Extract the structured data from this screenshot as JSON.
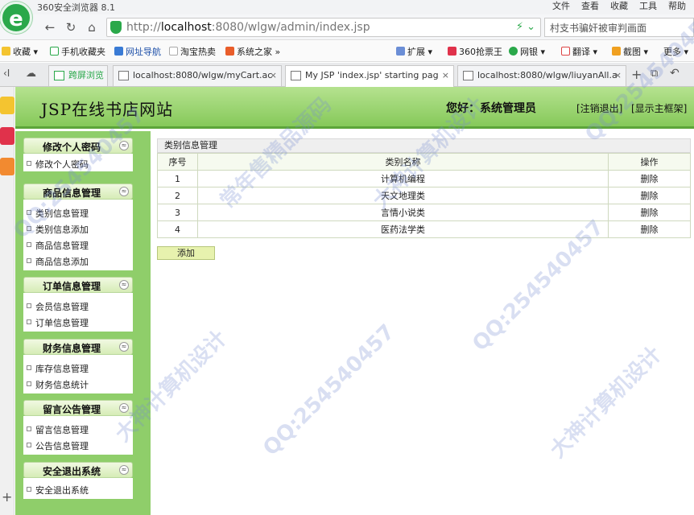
{
  "browser": {
    "title": "360安全浏览器 8.1",
    "logo_glyph": "e",
    "menu": [
      "文件",
      "查看",
      "收藏",
      "工具",
      "帮助"
    ],
    "address_prefix": "http://",
    "address_host": "localhost",
    "address_rest": ":8080/wlgw/admin/index.jsp",
    "search_text": "村支书骗奸被审判画面",
    "bookmarks": [
      "收藏",
      "手机收藏夹",
      "网址导航",
      "淘宝热卖",
      "系统之家",
      "扩展",
      "360抢票王",
      "网银",
      "翻译",
      "截图",
      "更多"
    ],
    "tabs": [
      {
        "label": "跨屏浏览"
      },
      {
        "label": "localhost:8080/wlgw/myCart.ac"
      },
      {
        "label": "My JSP 'index.jsp' starting pag"
      },
      {
        "label": "localhost:8080/wlgw/liuyanAll.a"
      }
    ],
    "tab_close": "×"
  },
  "site": {
    "title": "JSP在线书店网站",
    "greeting_label": "您好：",
    "greeting_user": "系统管理员",
    "logout": "[注销退出]",
    "show_frame": "[显示主框架]"
  },
  "sidebar": {
    "collapse_glyph": "≈",
    "groups": [
      {
        "title": "修改个人密码",
        "items": [
          "修改个人密码"
        ]
      },
      {
        "title": "商品信息管理",
        "items": [
          "类别信息管理",
          "类别信息添加",
          "商品信息管理",
          "商品信息添加"
        ]
      },
      {
        "title": "订单信息管理",
        "items": [
          "会员信息管理",
          "订单信息管理"
        ]
      },
      {
        "title": "财务信息管理",
        "items": [
          "库存信息管理",
          "财务信息统计"
        ]
      },
      {
        "title": "留言公告管理",
        "items": [
          "留言信息管理",
          "公告信息管理"
        ]
      },
      {
        "title": "安全退出系统",
        "items": [
          "安全退出系统"
        ]
      }
    ]
  },
  "content": {
    "panel_title": "类别信息管理",
    "columns": [
      "序号",
      "类别名称",
      "操作"
    ],
    "rows": [
      {
        "id": "1",
        "name": "计算机编程",
        "action": "删除"
      },
      {
        "id": "2",
        "name": "天文地理类",
        "action": "删除"
      },
      {
        "id": "3",
        "name": "言情小说类",
        "action": "删除"
      },
      {
        "id": "4",
        "name": "医药法学类",
        "action": "删除"
      }
    ],
    "add_label": "添加"
  },
  "watermark": [
    "QQ:254540457",
    "大神计算机设计",
    "常年售精品源码"
  ]
}
